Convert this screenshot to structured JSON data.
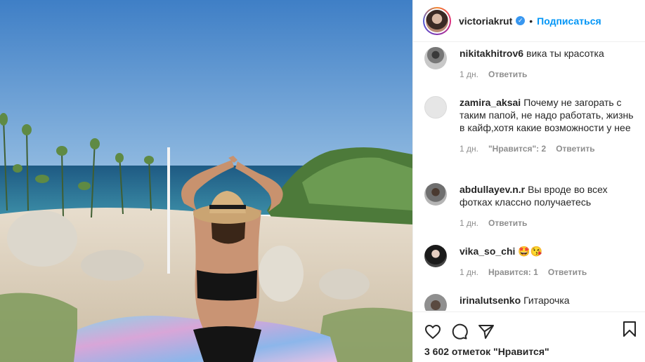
{
  "header": {
    "username": "victoriakrut",
    "follow_label": "Подписаться",
    "separator": "•"
  },
  "comments": [
    {
      "user": "nikitakhitrov6",
      "text": "вика ты красотка",
      "time": "1 дн.",
      "reply": "Ответить"
    },
    {
      "user": "zamira_aksai",
      "text": "Почему не загорать с таким папой, не надо работать, жизнь в кайф,хотя какие возможности у нее",
      "time": "1 дн.",
      "likes": "\"Нравится\": 2",
      "reply": "Ответить"
    },
    {
      "user": "abdullayev.n.r",
      "text": "Вы вроде во всех фотках классно получаетесь",
      "time": "1 дн.",
      "reply": "Ответить"
    },
    {
      "user": "vika_so_chi",
      "text": "🤩😘",
      "time": "1 дн.",
      "likes": "Нравится: 1",
      "reply": "Ответить"
    },
    {
      "user": "irinalutsenko",
      "text": "Гитарочка"
    }
  ],
  "footer": {
    "likes_text": "3 602 отметок \"Нравится\""
  },
  "icons": [
    "heart-icon",
    "comment-icon",
    "share-icon",
    "bookmark-icon",
    "verified-badge-icon"
  ]
}
